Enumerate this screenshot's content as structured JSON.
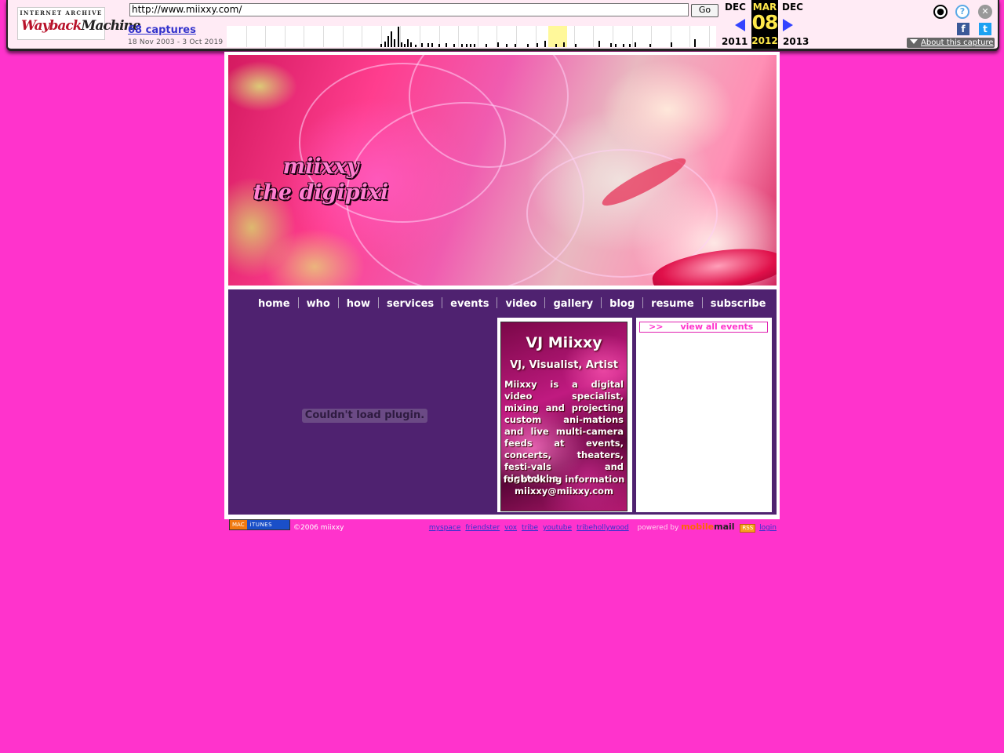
{
  "wayback": {
    "logo_top": "INTERNET ARCHIVE",
    "logo_main_a": "Wayback",
    "logo_main_b": "Machine",
    "url": "http://www.miixxy.com/",
    "go_label": "Go",
    "captures": "68 captures",
    "range": "18 Nov 2003 - 3 Oct 2019",
    "prev_month": "DEC",
    "prev_year": "2011",
    "cur_month": "MAR",
    "cur_day": "08",
    "cur_year": "2012",
    "next_month": "DEC",
    "next_year": "2013",
    "about": "About this capture",
    "icons": {
      "user": "user-icon",
      "help": "help-icon",
      "close": "close-icon",
      "facebook": "facebook-icon",
      "twitter": "twitter-icon"
    }
  },
  "site": {
    "banner_title_1": "miixxy",
    "banner_title_2": "the digipixi",
    "nav": [
      "home",
      "who",
      "how",
      "services",
      "events",
      "video",
      "gallery",
      "blog",
      "resume",
      "subscribe"
    ],
    "plugin_msg": "Couldn't load plugin.",
    "promo": {
      "title": "VJ Miixxy",
      "subtitle": "VJ, Visualist, Artist",
      "body": "Miixxy is a digital video specialist, mixing and projecting custom ani-mations and live multi-camera feeds at events, concerts, theaters, festi-vals and nightclubs.",
      "booking": "for booking information",
      "email": "miixxy@miixxy.com"
    },
    "events_arrow": ">>",
    "events_link": "view all events"
  },
  "footer": {
    "itunes_mac": "MAC",
    "itunes_label": "iTUNES",
    "copyright": "©2006 miixxy",
    "links": [
      "myspace",
      "friendster",
      "vox",
      "tribe",
      "youtube",
      "tribehollywood"
    ],
    "powered": "powered by",
    "brand_a": "mobile",
    "brand_b": "mail",
    "rss": "RSS",
    "login": "login"
  },
  "colors": {
    "page_bg": "#ff33cc",
    "panel": "#4f2270",
    "accent": "#ff33cc"
  }
}
